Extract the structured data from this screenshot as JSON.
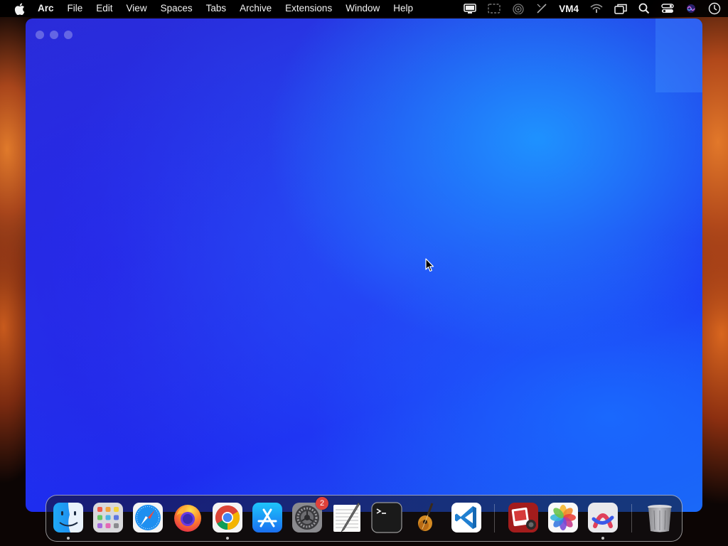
{
  "menubar": {
    "app_name": "Arc",
    "items": [
      "File",
      "Edit",
      "View",
      "Spaces",
      "Tabs",
      "Archive",
      "Extensions",
      "Window",
      "Help"
    ],
    "status": {
      "vm_label": "VM4",
      "icons": [
        "display-icon",
        "screen-capture-icon",
        "airdrop-icon",
        "pen-icon",
        "wifi-icon",
        "screen-mirroring-icon",
        "spotlight-search-icon",
        "control-center-icon",
        "siri-icon",
        "clock-icon"
      ]
    }
  },
  "window": {
    "app": "Arc",
    "colors": {
      "primary": "#1f32ee",
      "highlight": "#1e96ff"
    }
  },
  "dock": {
    "apps": [
      {
        "name": "Finder",
        "icon": "finder-icon",
        "running": true
      },
      {
        "name": "Launchpad",
        "icon": "launchpad-icon",
        "running": false
      },
      {
        "name": "Safari",
        "icon": "safari-icon",
        "running": false
      },
      {
        "name": "Firefox",
        "icon": "firefox-icon",
        "running": false
      },
      {
        "name": "Google Chrome",
        "icon": "chrome-icon",
        "running": true
      },
      {
        "name": "App Store",
        "icon": "app-store-icon",
        "running": false
      },
      {
        "name": "System Settings",
        "icon": "system-settings-icon",
        "running": false,
        "badge": "2"
      },
      {
        "name": "TextEdit",
        "icon": "textedit-icon",
        "running": false
      },
      {
        "name": "Terminal",
        "icon": "terminal-icon",
        "running": false
      },
      {
        "name": "GarageBand",
        "icon": "garageband-icon",
        "running": false
      },
      {
        "name": "Visual Studio Code",
        "icon": "vscode-icon",
        "running": false
      },
      {
        "name": "Photo Booth",
        "icon": "photo-booth-icon",
        "running": false
      },
      {
        "name": "Photos",
        "icon": "photos-icon",
        "running": false
      },
      {
        "name": "Arc",
        "icon": "arc-icon",
        "running": true
      },
      {
        "name": "Trash",
        "icon": "trash-icon",
        "running": false
      }
    ]
  }
}
